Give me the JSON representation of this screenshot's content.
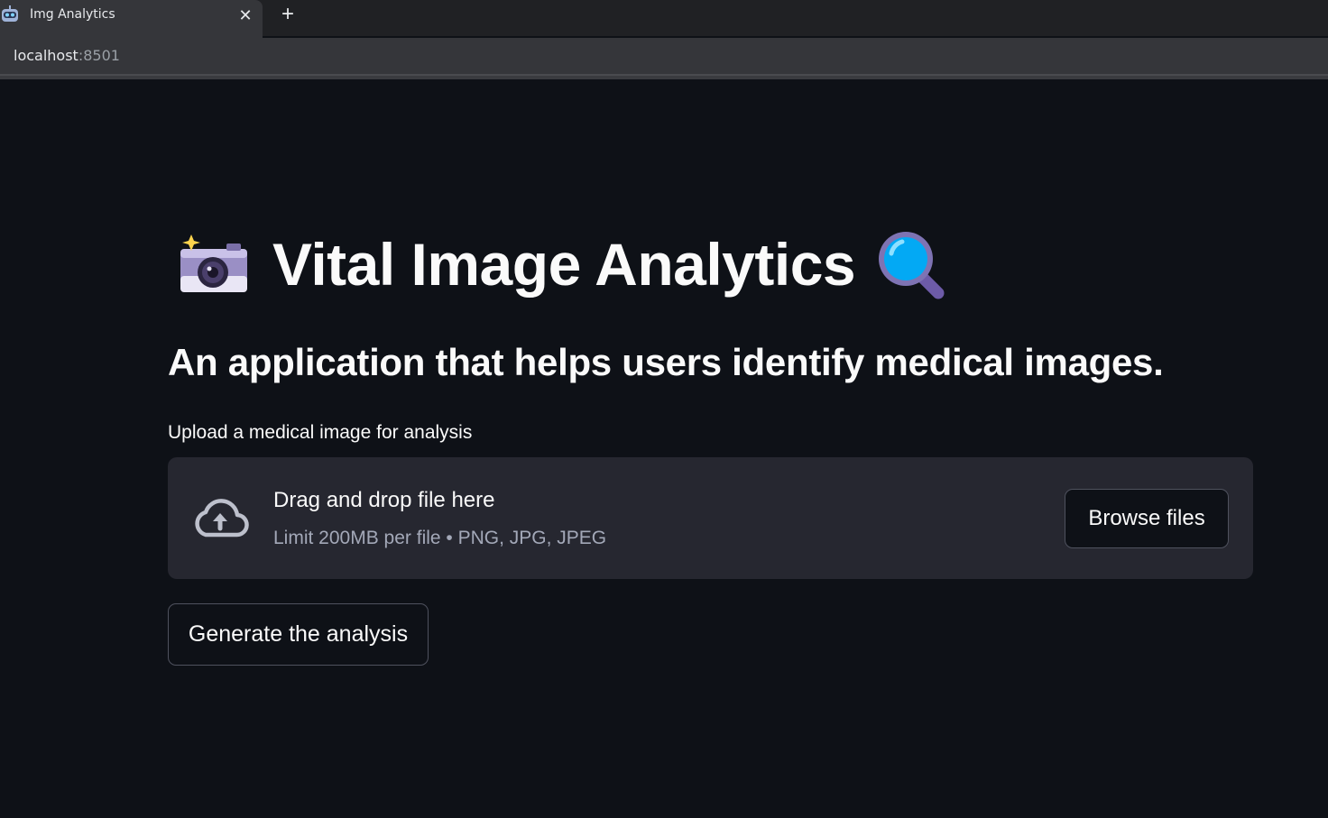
{
  "browser": {
    "tab_title": "Img Analytics",
    "tab_close_icon": "close-icon",
    "new_tab_icon": "plus-icon",
    "favicon_icon": "robot-icon",
    "new_tab_symbol": "+",
    "close_symbol": "✕",
    "url_host": "localhost",
    "url_port": ":8501"
  },
  "app": {
    "title": "Vital Image Analytics",
    "title_left_icon": "camera-with-flash-icon",
    "title_right_icon": "magnifying-glass-icon",
    "subtitle": "An application that helps users identify medical images.",
    "uploader": {
      "label": "Upload a medical image for analysis",
      "icon": "cloud-upload-icon",
      "drop_text": "Drag and drop file here",
      "limit_text": "Limit 200MB per file • PNG, JPG, JPEG",
      "browse_label": "Browse files"
    },
    "generate_label": "Generate the analysis"
  },
  "colors": {
    "background": "#0e1117",
    "dropzone": "#262730",
    "text": "#fafafa",
    "muted_text": "#a3a8b8",
    "button_border": "#4f525e"
  }
}
